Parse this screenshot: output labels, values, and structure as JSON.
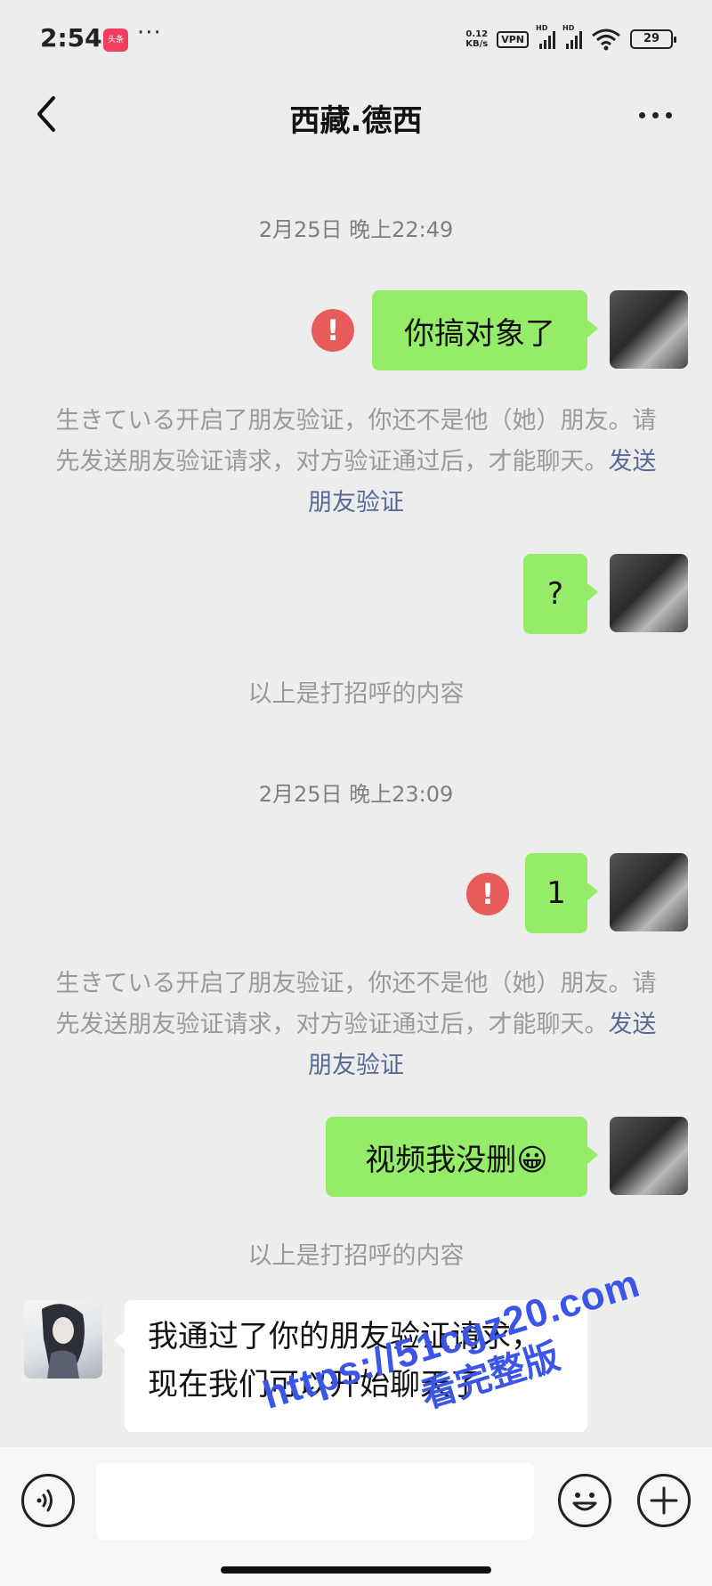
{
  "status_bar": {
    "time": "2:54",
    "app_badge": "头条",
    "more": "···",
    "net_speed_value": "0.12",
    "net_speed_unit": "KB/s",
    "vpn": "VPN",
    "hd1": "HD",
    "hd2": "HD",
    "battery": "29"
  },
  "nav": {
    "title": "西藏.德西"
  },
  "chat": {
    "timestamp_1": "2月25日 晚上22:49",
    "msg_1": "你搞对象了",
    "system_1_text": "生きている开启了朋友验证，你还不是他（她）朋友。请先发送朋友验证请求，对方验证通过后，才能聊天。",
    "system_1_link": "发送朋友验证",
    "msg_2": "?",
    "greeting_note_1": "以上是打招呼的内容",
    "timestamp_2": "2月25日 晚上23:09",
    "msg_3": "1",
    "system_2_text": "生きている开启了朋友验证，你还不是他（她）朋友。请先发送朋友验证请求，对方验证通过后，才能聊天。",
    "system_2_link": "发送朋友验证",
    "msg_4": "视频我没删😀",
    "greeting_note_2": "以上是打招呼的内容",
    "incoming_msg_line1": "我通过了你的朋友验证请求，",
    "incoming_msg_line2": "现在我们可以开始聊天了",
    "fail_mark": "!"
  },
  "input_bar": {
    "placeholder": ""
  },
  "watermark": {
    "url": "https://51cgz20.com",
    "sub": "看完整版"
  },
  "colors": {
    "background": "#ededed",
    "outgoing_bubble": "#95ec69",
    "incoming_bubble": "#ffffff",
    "link": "#576b95",
    "fail_icon": "#e85b5b",
    "watermark": "#3b55e6"
  },
  "icons": [
    "back-arrow-icon",
    "more-dots-icon",
    "voice-icon",
    "emoji-icon",
    "plus-icon",
    "send-failed-icon",
    "wifi-icon",
    "signal-icon",
    "battery-icon"
  ]
}
